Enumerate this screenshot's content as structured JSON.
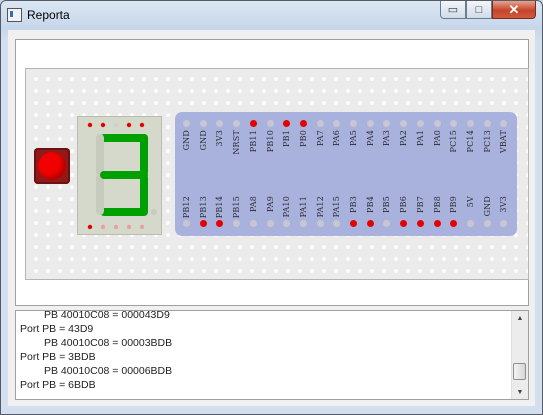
{
  "window": {
    "title": "Reporta"
  },
  "caption_buttons": {
    "minimize": "▭",
    "maximize": "□",
    "close": "✕"
  },
  "colors": {
    "led_on": "#f20000",
    "segment_on": "#00a000",
    "pin_active": "#e30000",
    "mcu_board": "#a9b2dd"
  },
  "seven_segment": {
    "digit": "3",
    "segments_on": [
      "a",
      "b",
      "c",
      "d",
      "g"
    ]
  },
  "mcu": {
    "top_pins": [
      {
        "label": "GND",
        "active": false
      },
      {
        "label": "GND",
        "active": false
      },
      {
        "label": "3V3",
        "active": false
      },
      {
        "label": "NRST",
        "active": false
      },
      {
        "label": "PB11",
        "active": true
      },
      {
        "label": "PB10",
        "active": false
      },
      {
        "label": "PB1",
        "active": true
      },
      {
        "label": "PB0",
        "active": true
      },
      {
        "label": "PA7",
        "active": false
      },
      {
        "label": "PA6",
        "active": false
      },
      {
        "label": "PA5",
        "active": false
      },
      {
        "label": "PA4",
        "active": false
      },
      {
        "label": "PA3",
        "active": false
      },
      {
        "label": "PA2",
        "active": false
      },
      {
        "label": "PA1",
        "active": false
      },
      {
        "label": "PA0",
        "active": false
      },
      {
        "label": "PC15",
        "active": false
      },
      {
        "label": "PC14",
        "active": false
      },
      {
        "label": "PC13",
        "active": false
      },
      {
        "label": "VBAT",
        "active": false
      }
    ],
    "bottom_pins": [
      {
        "label": "PB12",
        "active": false
      },
      {
        "label": "PB13",
        "active": true
      },
      {
        "label": "PB14",
        "active": true
      },
      {
        "label": "PB15",
        "active": false
      },
      {
        "label": "PA8",
        "active": false
      },
      {
        "label": "PA9",
        "active": false
      },
      {
        "label": "PA10",
        "active": false
      },
      {
        "label": "PA11",
        "active": false
      },
      {
        "label": "PA12",
        "active": false
      },
      {
        "label": "PA15",
        "active": false
      },
      {
        "label": "PB3",
        "active": true
      },
      {
        "label": "PB4",
        "active": true
      },
      {
        "label": "PB5",
        "active": false
      },
      {
        "label": "PB6",
        "active": true
      },
      {
        "label": "PB7",
        "active": true
      },
      {
        "label": "PB8",
        "active": true
      },
      {
        "label": "PB9",
        "active": true
      },
      {
        "label": "5V",
        "active": false
      },
      {
        "label": "GND",
        "active": false
      },
      {
        "label": "3V3",
        "active": false
      }
    ]
  },
  "log": {
    "lines": [
      {
        "text": "PB 40010C08 = 000043D9",
        "indent": true
      },
      {
        "text": "Port PB = 43D9",
        "indent": false
      },
      {
        "text": "PB 40010C08 = 00003BDB",
        "indent": true
      },
      {
        "text": "Port PB = 3BDB",
        "indent": false
      },
      {
        "text": "PB 40010C08 = 00006BDB",
        "indent": true
      },
      {
        "text": "Port PB = 6BDB",
        "indent": false
      }
    ]
  },
  "scrollbar": {
    "up": "▲",
    "down": "▼"
  }
}
